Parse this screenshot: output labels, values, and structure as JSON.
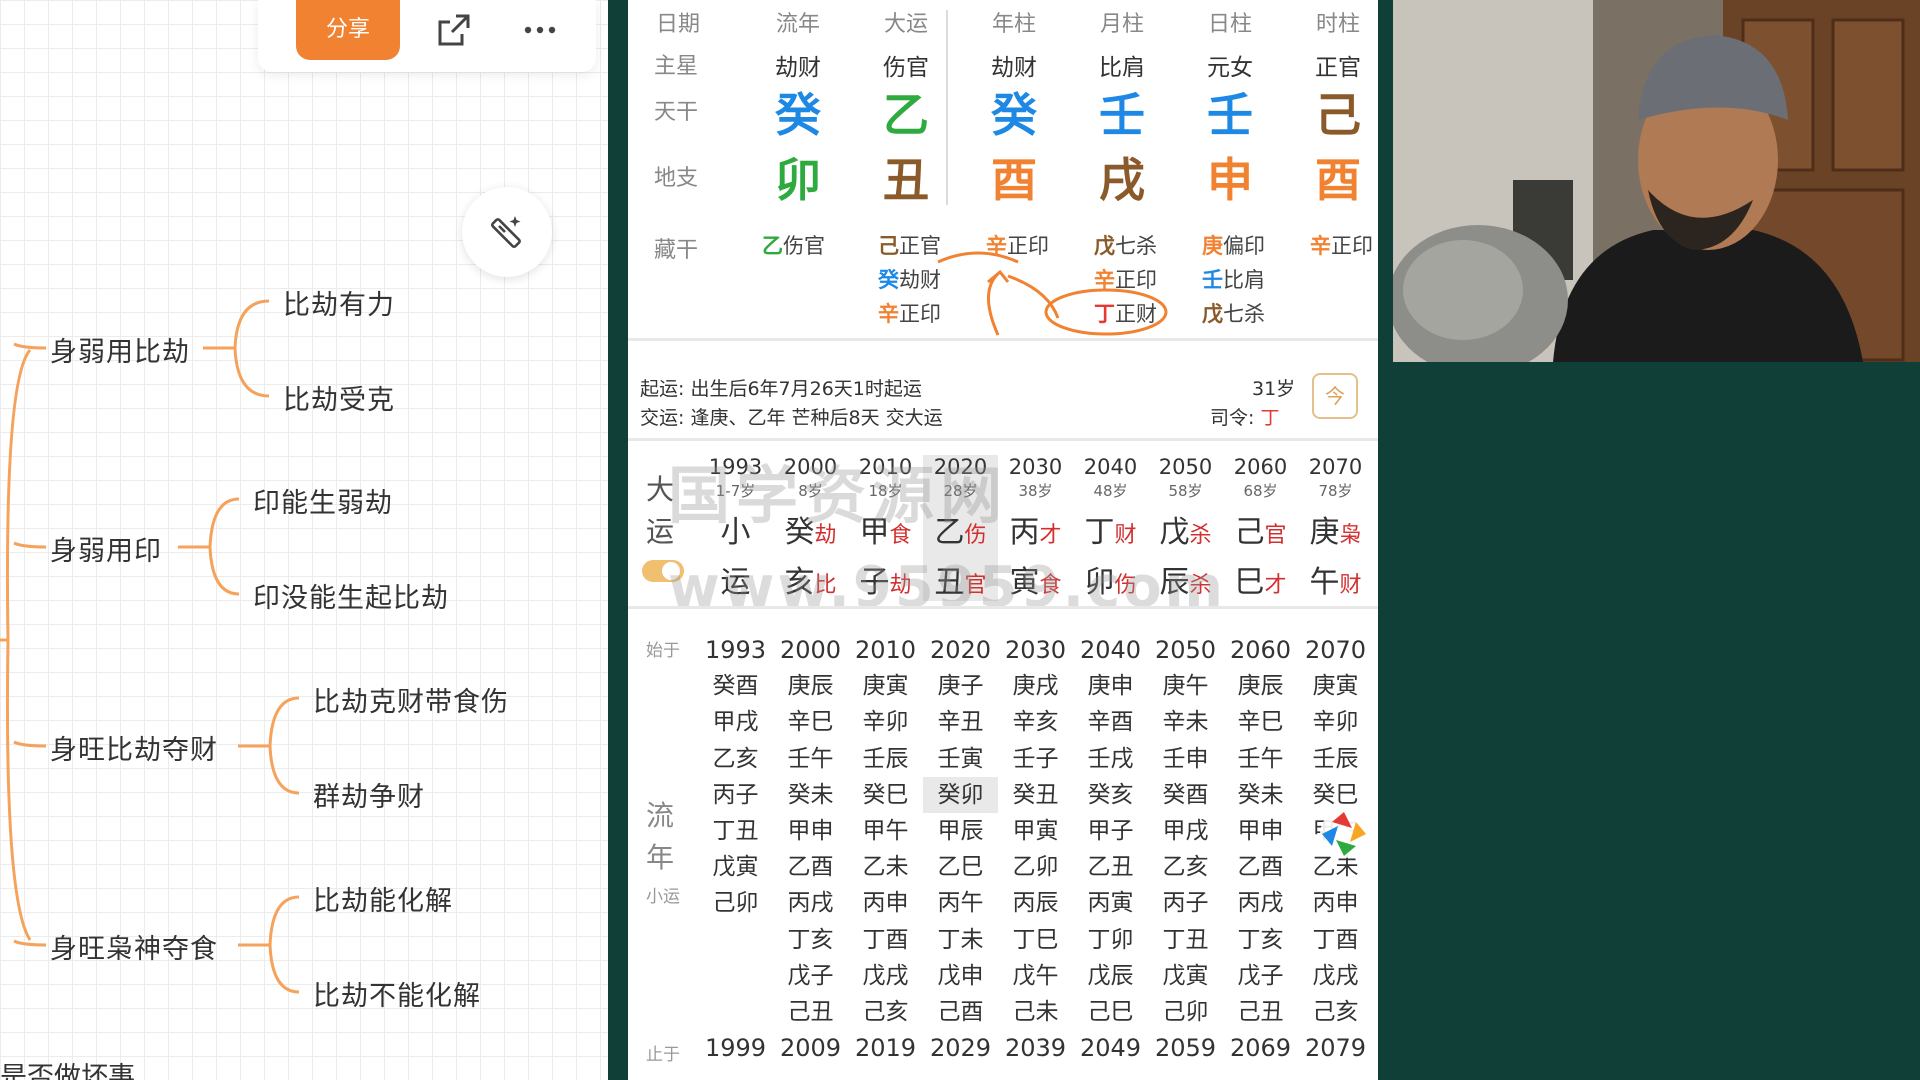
{
  "toolbar": {
    "share_label": "分享"
  },
  "mindmap": {
    "groups": [
      {
        "label": "身弱用比劫",
        "children": [
          "比劫有力",
          "比劫受克"
        ]
      },
      {
        "label": "身弱用印",
        "children": [
          "印能生弱劫",
          "印没能生起比劫"
        ]
      },
      {
        "label": "身旺比劫夺财",
        "children": [
          "比劫克财带食伤",
          "群劫争财"
        ]
      },
      {
        "label": "身旺枭神夺食",
        "children": [
          "比劫能化解",
          "比劫不能化解"
        ]
      }
    ],
    "bottom_text": "是否做坏事"
  },
  "chart": {
    "headers": [
      "日期",
      "流年",
      "大运",
      "年柱",
      "月柱",
      "日柱",
      "时柱"
    ],
    "row_labels": {
      "star": "主星",
      "stem": "天干",
      "branch": "地支",
      "hidden": "藏干"
    },
    "stars": [
      "劫财",
      "伤官",
      "劫财",
      "比肩",
      "元女",
      "正官"
    ],
    "stems": [
      {
        "char": "癸",
        "color": "#1e88e5"
      },
      {
        "char": "乙",
        "color": "#2eaa3e"
      },
      {
        "char": "癸",
        "color": "#1e88e5"
      },
      {
        "char": "壬",
        "color": "#1e88e5"
      },
      {
        "char": "壬",
        "color": "#1e88e5"
      },
      {
        "char": "己",
        "color": "#8b5a2b"
      }
    ],
    "branches": [
      {
        "char": "卯",
        "color": "#2eaa3e"
      },
      {
        "char": "丑",
        "color": "#8b5a2b"
      },
      {
        "char": "酉",
        "color": "#f08232"
      },
      {
        "char": "戌",
        "color": "#8b5a2b"
      },
      {
        "char": "申",
        "color": "#f08232"
      },
      {
        "char": "酉",
        "color": "#f08232"
      }
    ],
    "hidden": [
      [
        {
          "g": "乙",
          "s": "伤官",
          "c": "#2eaa3e"
        }
      ],
      [
        {
          "g": "己",
          "s": "正官",
          "c": "#8b5a2b"
        },
        {
          "g": "癸",
          "s": "劫财",
          "c": "#1e88e5"
        },
        {
          "g": "辛",
          "s": "正印",
          "c": "#f08232"
        }
      ],
      [
        {
          "g": "辛",
          "s": "正印",
          "c": "#f08232"
        }
      ],
      [
        {
          "g": "戊",
          "s": "七杀",
          "c": "#8b5a2b"
        },
        {
          "g": "辛",
          "s": "正印",
          "c": "#f08232"
        },
        {
          "g": "丁",
          "s": "正财",
          "c": "#e53935"
        }
      ],
      [
        {
          "g": "庚",
          "s": "偏印",
          "c": "#f08232"
        },
        {
          "g": "壬",
          "s": "比肩",
          "c": "#1e88e5"
        },
        {
          "g": "戊",
          "s": "七杀",
          "c": "#8b5a2b"
        }
      ],
      [
        {
          "g": "辛",
          "s": "正印",
          "c": "#f08232"
        }
      ]
    ],
    "qiyun_label": "起运:",
    "qiyun_text": "出生后6年7月26天1时起运",
    "jiaoyun_label": "交运:",
    "jiaoyun_text": "逢庚、乙年 芒种后8天 交大运",
    "age": "31岁",
    "siling_label": "司令:",
    "siling_value": "丁",
    "calendar_icon": "今",
    "dayun_label": [
      "大",
      "运"
    ],
    "dayun": [
      {
        "year": "1993",
        "age": "1-7岁",
        "top": "小",
        "top_t": "",
        "bot": "运",
        "bot_t": ""
      },
      {
        "year": "2000",
        "age": "8岁",
        "top": "癸",
        "top_t": "劫",
        "bot": "亥",
        "bot_t": "比"
      },
      {
        "year": "2010",
        "age": "18岁",
        "top": "甲",
        "top_t": "食",
        "bot": "子",
        "bot_t": "劫"
      },
      {
        "year": "2020",
        "age": "28岁",
        "top": "乙",
        "top_t": "伤",
        "bot": "丑",
        "bot_t": "官"
      },
      {
        "year": "2030",
        "age": "38岁",
        "top": "丙",
        "top_t": "才",
        "bot": "寅",
        "bot_t": "食"
      },
      {
        "year": "2040",
        "age": "48岁",
        "top": "丁",
        "top_t": "财",
        "bot": "卯",
        "bot_t": "伤"
      },
      {
        "year": "2050",
        "age": "58岁",
        "top": "戊",
        "top_t": "杀",
        "bot": "辰",
        "bot_t": "杀"
      },
      {
        "year": "2060",
        "age": "68岁",
        "top": "己",
        "top_t": "官",
        "bot": "巳",
        "bot_t": "才"
      },
      {
        "year": "2070",
        "age": "78岁",
        "top": "庚",
        "top_t": "枭",
        "bot": "午",
        "bot_t": "财"
      }
    ],
    "watermark": "国学资源网",
    "watermark_url": "www.95959.com",
    "liunian_start_label": "始于",
    "liunian_end_label": "止于",
    "liunian_label": [
      "流",
      "年"
    ],
    "xiaoyun_label": "小运",
    "liunian": [
      {
        "start": "1993",
        "end": "1999",
        "cells": [
          "癸酉",
          "甲戌",
          "乙亥",
          "丙子",
          "丁丑",
          "戊寅",
          "己卯"
        ]
      },
      {
        "start": "2000",
        "end": "2009",
        "cells": [
          "庚辰",
          "辛巳",
          "壬午",
          "癸未",
          "甲申",
          "乙酉",
          "丙戌",
          "丁亥",
          "戊子",
          "己丑"
        ]
      },
      {
        "start": "2010",
        "end": "2019",
        "cells": [
          "庚寅",
          "辛卯",
          "壬辰",
          "癸巳",
          "甲午",
          "乙未",
          "丙申",
          "丁酉",
          "戊戌",
          "己亥"
        ]
      },
      {
        "start": "2020",
        "end": "2029",
        "cells": [
          "庚子",
          "辛丑",
          "壬寅",
          "癸卯",
          "甲辰",
          "乙巳",
          "丙午",
          "丁未",
          "戊申",
          "己酉"
        ]
      },
      {
        "start": "2030",
        "end": "2039",
        "cells": [
          "庚戌",
          "辛亥",
          "壬子",
          "癸丑",
          "甲寅",
          "乙卯",
          "丙辰",
          "丁巳",
          "戊午",
          "己未"
        ]
      },
      {
        "start": "2040",
        "end": "2049",
        "cells": [
          "庚申",
          "辛酉",
          "壬戌",
          "癸亥",
          "甲子",
          "乙丑",
          "丙寅",
          "丁卯",
          "戊辰",
          "己巳"
        ]
      },
      {
        "start": "2050",
        "end": "2059",
        "cells": [
          "庚午",
          "辛未",
          "壬申",
          "癸酉",
          "甲戌",
          "乙亥",
          "丙子",
          "丁丑",
          "戊寅",
          "己卯"
        ]
      },
      {
        "start": "2060",
        "end": "2069",
        "cells": [
          "庚辰",
          "辛巳",
          "壬午",
          "癸未",
          "甲申",
          "乙酉",
          "丙戌",
          "丁亥",
          "戊子",
          "己丑"
        ]
      },
      {
        "start": "2070",
        "end": "2079",
        "cells": [
          "庚寅",
          "辛卯",
          "壬辰",
          "癸巳",
          "甲午",
          "乙未",
          "丙申",
          "丁酉",
          "戊戌",
          "己亥"
        ]
      }
    ]
  },
  "colors": {
    "accent": "#f08232",
    "background": "#0f3f37"
  },
  "icons": [
    "share-out-icon",
    "more-icon",
    "magic-wand-icon",
    "calendar-icon",
    "camera-shutter-icon"
  ]
}
